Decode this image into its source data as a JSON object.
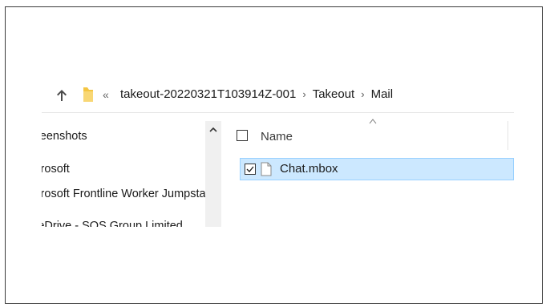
{
  "address_bar": {
    "overflow_glyph": "«",
    "crumbs": [
      {
        "label": "takeout-20220321T103914Z-001"
      },
      {
        "label": "Takeout"
      },
      {
        "label": "Mail"
      }
    ],
    "separator": "›",
    "icons": {
      "up": "up-arrow-icon",
      "folder": "folder-icon"
    }
  },
  "nav_pane": {
    "items": [
      {
        "label": "Screenshots"
      },
      {
        "label": "Microsoft"
      },
      {
        "label": "Microsoft Frontline Worker Jumpstart"
      },
      {
        "label": "OneDrive - SOS Group Limited"
      }
    ]
  },
  "file_list": {
    "column_name": "Name",
    "files": [
      {
        "name": "Chat.mbox",
        "checked": true,
        "selected": true
      }
    ]
  },
  "colors": {
    "selection_bg": "#cce8ff",
    "selection_border": "#99d1ff",
    "folder_yellow": "#f4c542",
    "up_arrow": "#4a4a4a"
  }
}
